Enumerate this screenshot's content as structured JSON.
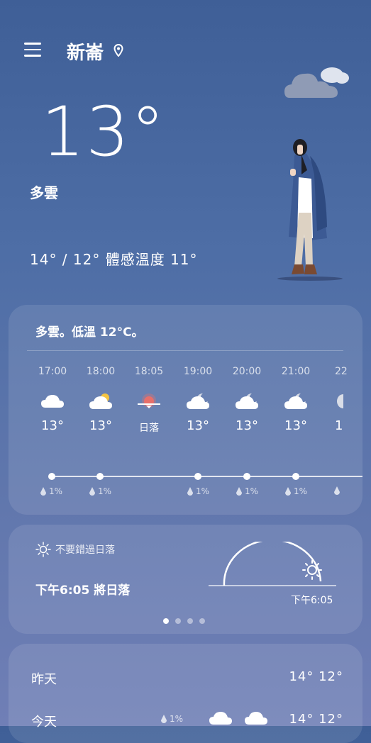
{
  "header": {
    "city": "新崙"
  },
  "current": {
    "temp": "13°",
    "condition": "多雲",
    "range_feels": "14° / 12° 體感溫度 11°"
  },
  "hourly": {
    "summary": "多雲。低溫 12°C。",
    "items": [
      {
        "time": "17:00",
        "icon": "cloud-icon",
        "value": "13°",
        "precip": "1%"
      },
      {
        "time": "18:00",
        "icon": "partly-sunny-icon",
        "value": "13°",
        "precip": "1%"
      },
      {
        "time": "18:05",
        "icon": "sunset-icon",
        "value": "日落",
        "precip": ""
      },
      {
        "time": "19:00",
        "icon": "cloudy-night-icon",
        "value": "13°",
        "precip": "1%"
      },
      {
        "time": "20:00",
        "icon": "cloudy-night-icon",
        "value": "13°",
        "precip": "1%"
      },
      {
        "time": "21:00",
        "icon": "cloudy-night-icon",
        "value": "13°",
        "precip": "1%"
      },
      {
        "time": "22",
        "icon": "cloudy-night-icon",
        "value": "1",
        "precip": ""
      }
    ]
  },
  "sunset": {
    "label": "不要錯過日落",
    "main": "下午6:05 將日落",
    "time": "下午6:05"
  },
  "daily": [
    {
      "day": "昨天",
      "temps": "14° 12°"
    },
    {
      "day": "今天",
      "precip": "1%",
      "temps": "14° 12°"
    }
  ],
  "colors": {
    "bg_top": "#3f5f97",
    "bg_bottom": "#707fb6",
    "sunset_red": "#e76f6a",
    "sun_yellow": "#f5c542"
  }
}
